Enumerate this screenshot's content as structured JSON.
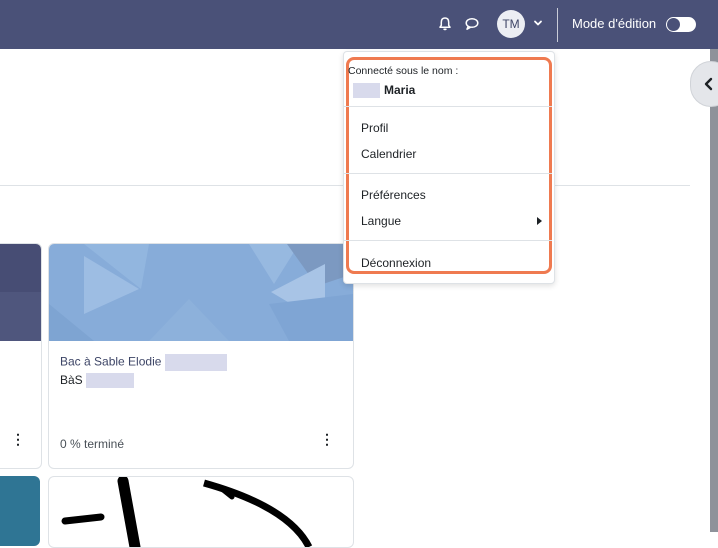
{
  "header": {
    "icons": [
      "bell-icon",
      "chat-bubble-icon"
    ],
    "avatar_initials": "TM",
    "edit_mode_label": "Mode d'édition",
    "edit_mode_on": false,
    "bar_color": "#4a5178"
  },
  "user_menu": {
    "logged_in_label": "Connecté sous le nom :",
    "user_name": "Maria",
    "items": [
      {
        "label": "Profil"
      },
      {
        "label": "Calendrier"
      },
      {
        "label": "Préférences"
      },
      {
        "label": "Langue",
        "has_submenu": true
      },
      {
        "label": "Déconnexion"
      }
    ],
    "highlight_color": "#ef7a50"
  },
  "courses": [
    {
      "title": "Bac à Sable Elodie",
      "short_name": "BàS",
      "progress": "0 % terminé",
      "menu": "⋮"
    }
  ],
  "partial_card": {
    "menu": "⋮"
  }
}
